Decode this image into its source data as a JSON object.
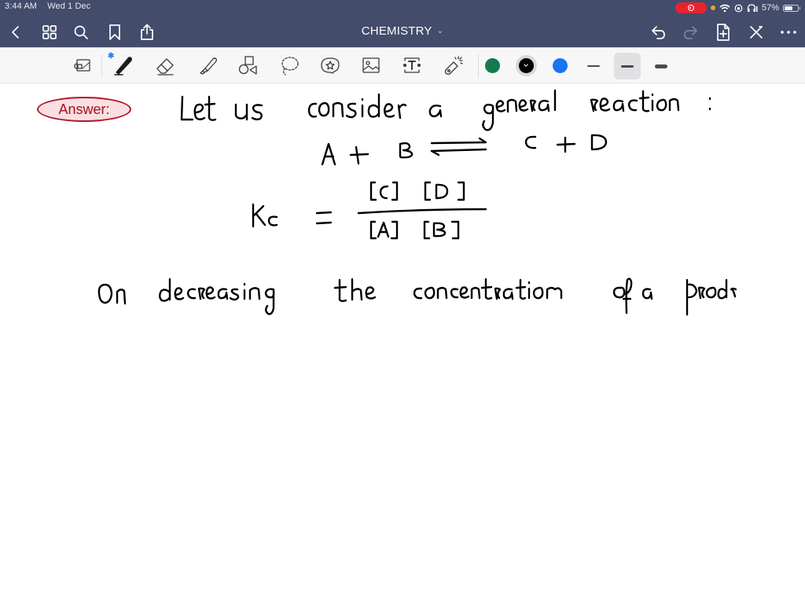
{
  "status_bar": {
    "time": "3:44 AM",
    "date": "Wed 1 Dec",
    "battery_percent": "57%",
    "battery_level": 0.57,
    "icons": [
      "screen-recording-icon",
      "mic-in-use-dot",
      "wifi-icon",
      "orientation-lock-icon",
      "headphones-icon",
      "battery-icon"
    ]
  },
  "nav": {
    "title": "CHEMISTRY",
    "left_icons": [
      "back-chevron-icon",
      "thumbnails-grid-icon",
      "search-icon",
      "bookmark-icon",
      "share-icon"
    ],
    "right_icons": [
      "undo-icon",
      "redo-icon",
      "add-page-icon",
      "close-x-icon",
      "more-icon"
    ]
  },
  "toolbar": {
    "tools": [
      "read-mode-icon",
      "pen-icon",
      "eraser-icon",
      "highlighter-icon",
      "shapes-icon",
      "lasso-icon",
      "sticker-icon",
      "image-icon",
      "text-box-icon",
      "laser-pointer-icon"
    ],
    "active_tool": "pen",
    "bluetooth_indicator": "✱",
    "colors": [
      {
        "name": "green",
        "hex": "#157a4e"
      },
      {
        "name": "black",
        "hex": "#000000",
        "selected": true
      },
      {
        "name": "blue",
        "hex": "#1a74f0"
      }
    ],
    "stroke_widths": [
      "thin",
      "medium",
      "thick"
    ],
    "selected_stroke": "medium"
  },
  "note": {
    "badge": "Answer:",
    "badge_color": "#a3111f",
    "lines": [
      "Let us consider a general reaction :",
      "A + B ⇌ C + D",
      "Kc = [C] [D] / [A] [B]",
      "On decreasing the concentration of a prod"
    ],
    "equation": {
      "lhs": "Kc",
      "numerator": "[C] [D]",
      "denominator": "[A] [B]"
    }
  }
}
